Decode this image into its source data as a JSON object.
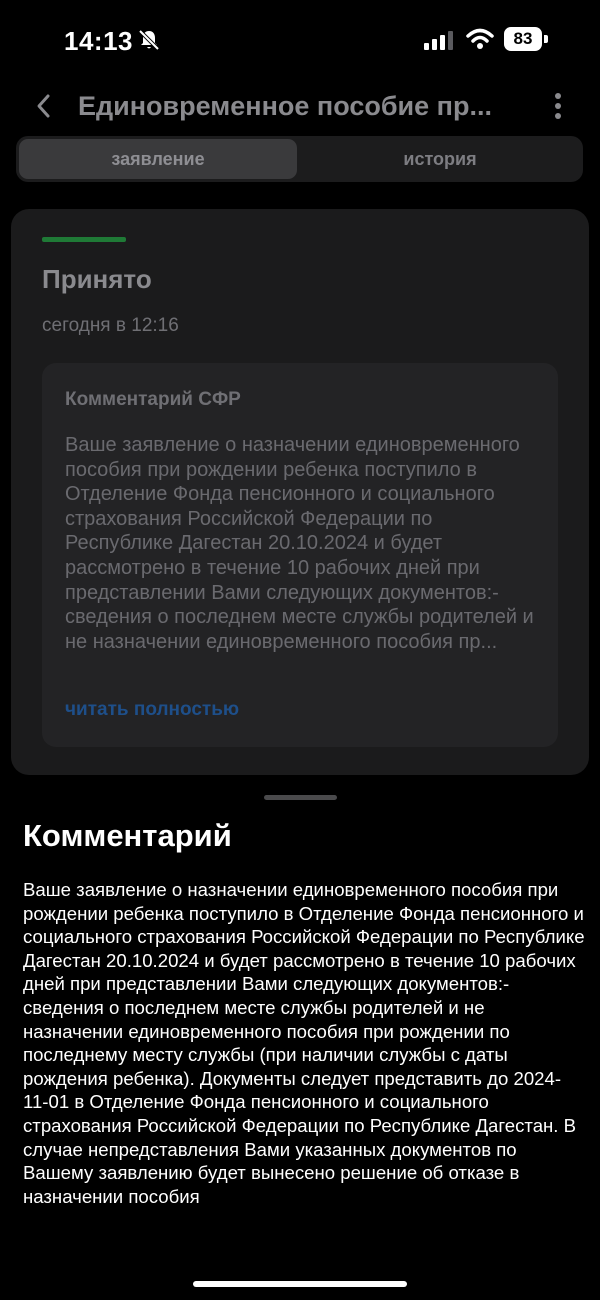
{
  "status_bar": {
    "time": "14:13",
    "battery": "83",
    "icons": [
      "bell-muted-icon",
      "signal-icon",
      "wifi-icon",
      "battery-icon"
    ]
  },
  "header": {
    "title": "Единовременное пособие пр...",
    "back_icon": "chevron-left-icon",
    "more_icon": "more-vertical-icon"
  },
  "tabs": [
    {
      "label": "заявление",
      "active": true
    },
    {
      "label": "история",
      "active": false
    }
  ],
  "status_card": {
    "status": "Принято",
    "date": "сегодня в 12:16",
    "accent_color": "#1f7a36",
    "comment": {
      "heading": "Комментарий СФР",
      "preview": "Ваше заявление о назначении единовременного пособия при рождении ребенка поступило в Отделение Фонда пенсионного и социального страхования Российской Федерации по Республике Дагестан 20.10.2024 и будет рассмотрено в течение 10 рабочих дней при представлении Вами следующих документов:- сведения о последнем месте службы родителей и не назначении единовременного пособия пр...",
      "read_more": "читать полностью"
    }
  },
  "sheet": {
    "title": "Комментарий",
    "body": "Ваше заявление о назначении единовременного пособия при рождении ребенка поступило в Отделение Фонда пенсионного и социального страхования Российской Федерации по Республике Дагестан 20.10.2024 и будет рассмотрено в течение 10 рабочих дней при представлении Вами следующих документов:- сведения о последнем месте службы родителей и не назначении единовременного пособия при рождении по последнему месту службы (при наличии службы с даты рождения ребенка). Документы следует представить до 2024-11-01 в Отделение Фонда пенсионного и социального страхования Российской Федерации по Республике Дагестан. В случае непредставления Вами указанных документов по Вашему заявлению будет вынесено решение об отказе в назначении пособия"
  }
}
